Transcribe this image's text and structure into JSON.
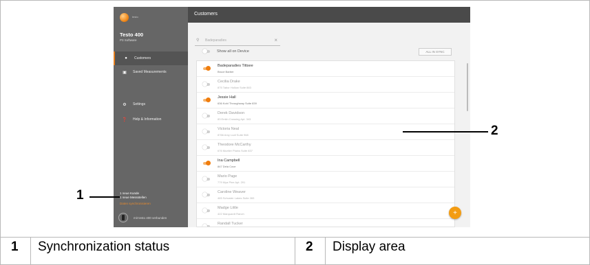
{
  "screenshot": {
    "app": {
      "logo_text": "testo",
      "product_name": "Testo 400",
      "product_sub": "P3 Software",
      "nav": [
        {
          "label": "Customers",
          "active": true
        },
        {
          "label": "Saved Measurements",
          "active": false
        },
        {
          "label": "Settings",
          "active": false
        },
        {
          "label": "Help & Information",
          "active": false
        }
      ],
      "sync_status": {
        "line1": "1 neue Kunde",
        "line2": "1 neue Messstellen",
        "link": "Daten synchronisieren"
      },
      "device_label": "mit testo 400 verbunden"
    },
    "page_title": "Customers",
    "search": {
      "value": "Badeparadies"
    },
    "show_all_label": "Show all on Device",
    "all_in_sync_label": "ALL IN SYNC",
    "customers": [
      {
        "name": "Badeparadies Tittsee",
        "address": "Bruce Barber",
        "on": true
      },
      {
        "name": "Cecilia Drake",
        "address": "875 Tabor Hollow Suite 883",
        "on": false
      },
      {
        "name": "Jessie Hall",
        "address": "636 Kohl Throughway Suite 839",
        "on": true
      },
      {
        "name": "Derek Davidson",
        "address": "83 Emlin Crossing Apt. 343",
        "on": false
      },
      {
        "name": "Victoria Neal",
        "address": "8766 Amy Loaf Suite 968",
        "on": false
      },
      {
        "name": "Theodore McCarthy",
        "address": "676 Mueller Plains Suite 837",
        "on": false
      },
      {
        "name": "Ina Campbell",
        "address": "847 Dela Cove",
        "on": true
      },
      {
        "name": "Mario Page",
        "address": "779 Mya Pine Apt. 291",
        "on": false
      },
      {
        "name": "Caroline Weaver",
        "address": "465 Schuster Lakes Suite 283",
        "on": false
      },
      {
        "name": "Madge Little",
        "address": "422 Marquardt Ranch",
        "on": false
      },
      {
        "name": "Randall Tucker",
        "address": "7780 Sawler Station",
        "on": false
      }
    ],
    "fab_label": "+"
  },
  "callouts": [
    {
      "number": "1"
    },
    {
      "number": "2"
    }
  ],
  "legend": [
    {
      "number": "1",
      "text": "Synchronization status"
    },
    {
      "number": "2",
      "text": "Display area"
    }
  ],
  "colors": {
    "accent": "#f07d0d",
    "sidebar": "#666666",
    "topbar": "#4a4a4a"
  }
}
